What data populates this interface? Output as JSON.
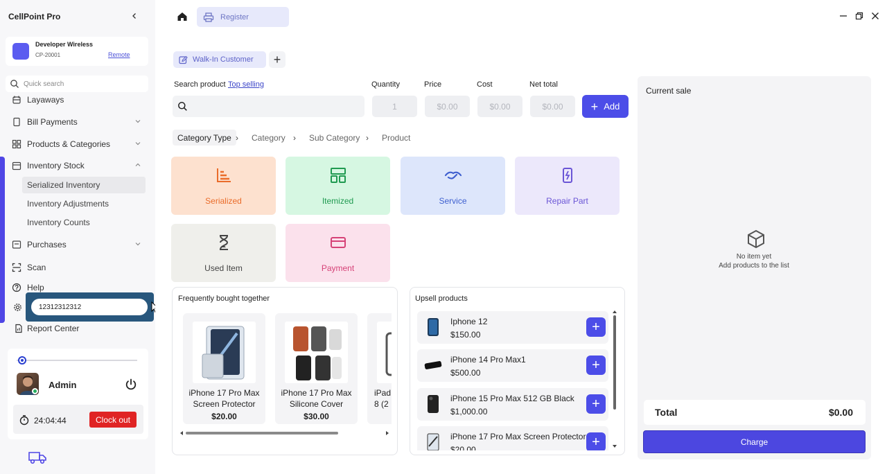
{
  "app": {
    "title": "CellPoint Pro"
  },
  "store": {
    "name": "Developer Wireless",
    "code": "CP-20001",
    "remote_label": "Remote"
  },
  "sidebar": {
    "search_placeholder": "Quick search",
    "items": [
      {
        "label": "Layaways",
        "icon": "layaway-icon"
      },
      {
        "label": "Bill Payments",
        "icon": "receipt-icon"
      },
      {
        "label": "Products & Categories",
        "icon": "grid-icon"
      },
      {
        "label": "Inventory Stock",
        "icon": "calendar-box-icon"
      },
      {
        "label": "Purchases",
        "icon": "purchase-icon"
      },
      {
        "label": "Scan",
        "icon": "scan-icon"
      },
      {
        "label": "Help",
        "icon": "help-icon"
      },
      {
        "label": "Report Center",
        "icon": "report-icon"
      }
    ],
    "inventory_sub": [
      "Serialized Inventory",
      "Inventory Adjustments",
      "Inventory Counts"
    ],
    "accent_color": "#4f46e5"
  },
  "barcode_input": {
    "value": "12312312312"
  },
  "user": {
    "name": "Admin",
    "timer": "24:04:44",
    "clockout_label": "Clock out"
  },
  "topbar": {
    "register_tab": "Register"
  },
  "customer": {
    "tab_label": "Walk-In Customer",
    "add_symbol": "+"
  },
  "form": {
    "search_label": "Search product",
    "top_selling_label": "Top selling",
    "quantity_label": "Quantity",
    "price_label": "Price",
    "cost_label": "Cost",
    "net_total_label": "Net total",
    "quantity_value": "1",
    "price_value": "$0.00",
    "cost_value": "$0.00",
    "net_total_value": "$0.00",
    "add_label": "Add"
  },
  "breadcrumb": [
    "Category Type",
    "Category",
    "Sub Category",
    "Product"
  ],
  "categories": [
    {
      "label": "Serialized",
      "bg": "#fde1cf",
      "fg": "#ea6c2a"
    },
    {
      "label": "Itemized",
      "bg": "#d6f7e2",
      "fg": "#1f9a50"
    },
    {
      "label": "Service",
      "bg": "#dde6fb",
      "fg": "#3e5fcf"
    },
    {
      "label": "Repair Part",
      "bg": "#ece8fb",
      "fg": "#6a55d6"
    },
    {
      "label": "Used Item",
      "bg": "#efefeb",
      "fg": "#444444"
    },
    {
      "label": "Payment",
      "bg": "#fbe1ec",
      "fg": "#d64277"
    }
  ],
  "fbt": {
    "title": "Frequently bought together",
    "items": [
      {
        "name_line1": "iPhone 17 Pro Max",
        "name_line2": "Screen Protector",
        "price": "$20.00"
      },
      {
        "name_line1": "iPhone 17 Pro Max",
        "name_line2": "Silicone Cover",
        "price": "$30.00"
      },
      {
        "name_line1": "iPad",
        "name_line2": "8 (2",
        "price": ""
      }
    ]
  },
  "upsell": {
    "title": "Upsell products",
    "items": [
      {
        "name": "Iphone 12",
        "price": "$150.00"
      },
      {
        "name": "iPhone 14 Pro Max1",
        "price": "$500.00"
      },
      {
        "name": "iPhone 15 Pro Max 512 GB Black",
        "price": "$1,000.00"
      },
      {
        "name": "iPhone 17 Pro Max Screen Protector",
        "price": "$20.00"
      }
    ]
  },
  "sale": {
    "title": "Current sale",
    "empty_line1": "No item yet",
    "empty_line2": "Add products to the list",
    "total_label": "Total",
    "total_value": "$0.00",
    "charge_label": "Charge"
  },
  "colors": {
    "primary": "#4c4de8",
    "danger": "#e02424"
  }
}
